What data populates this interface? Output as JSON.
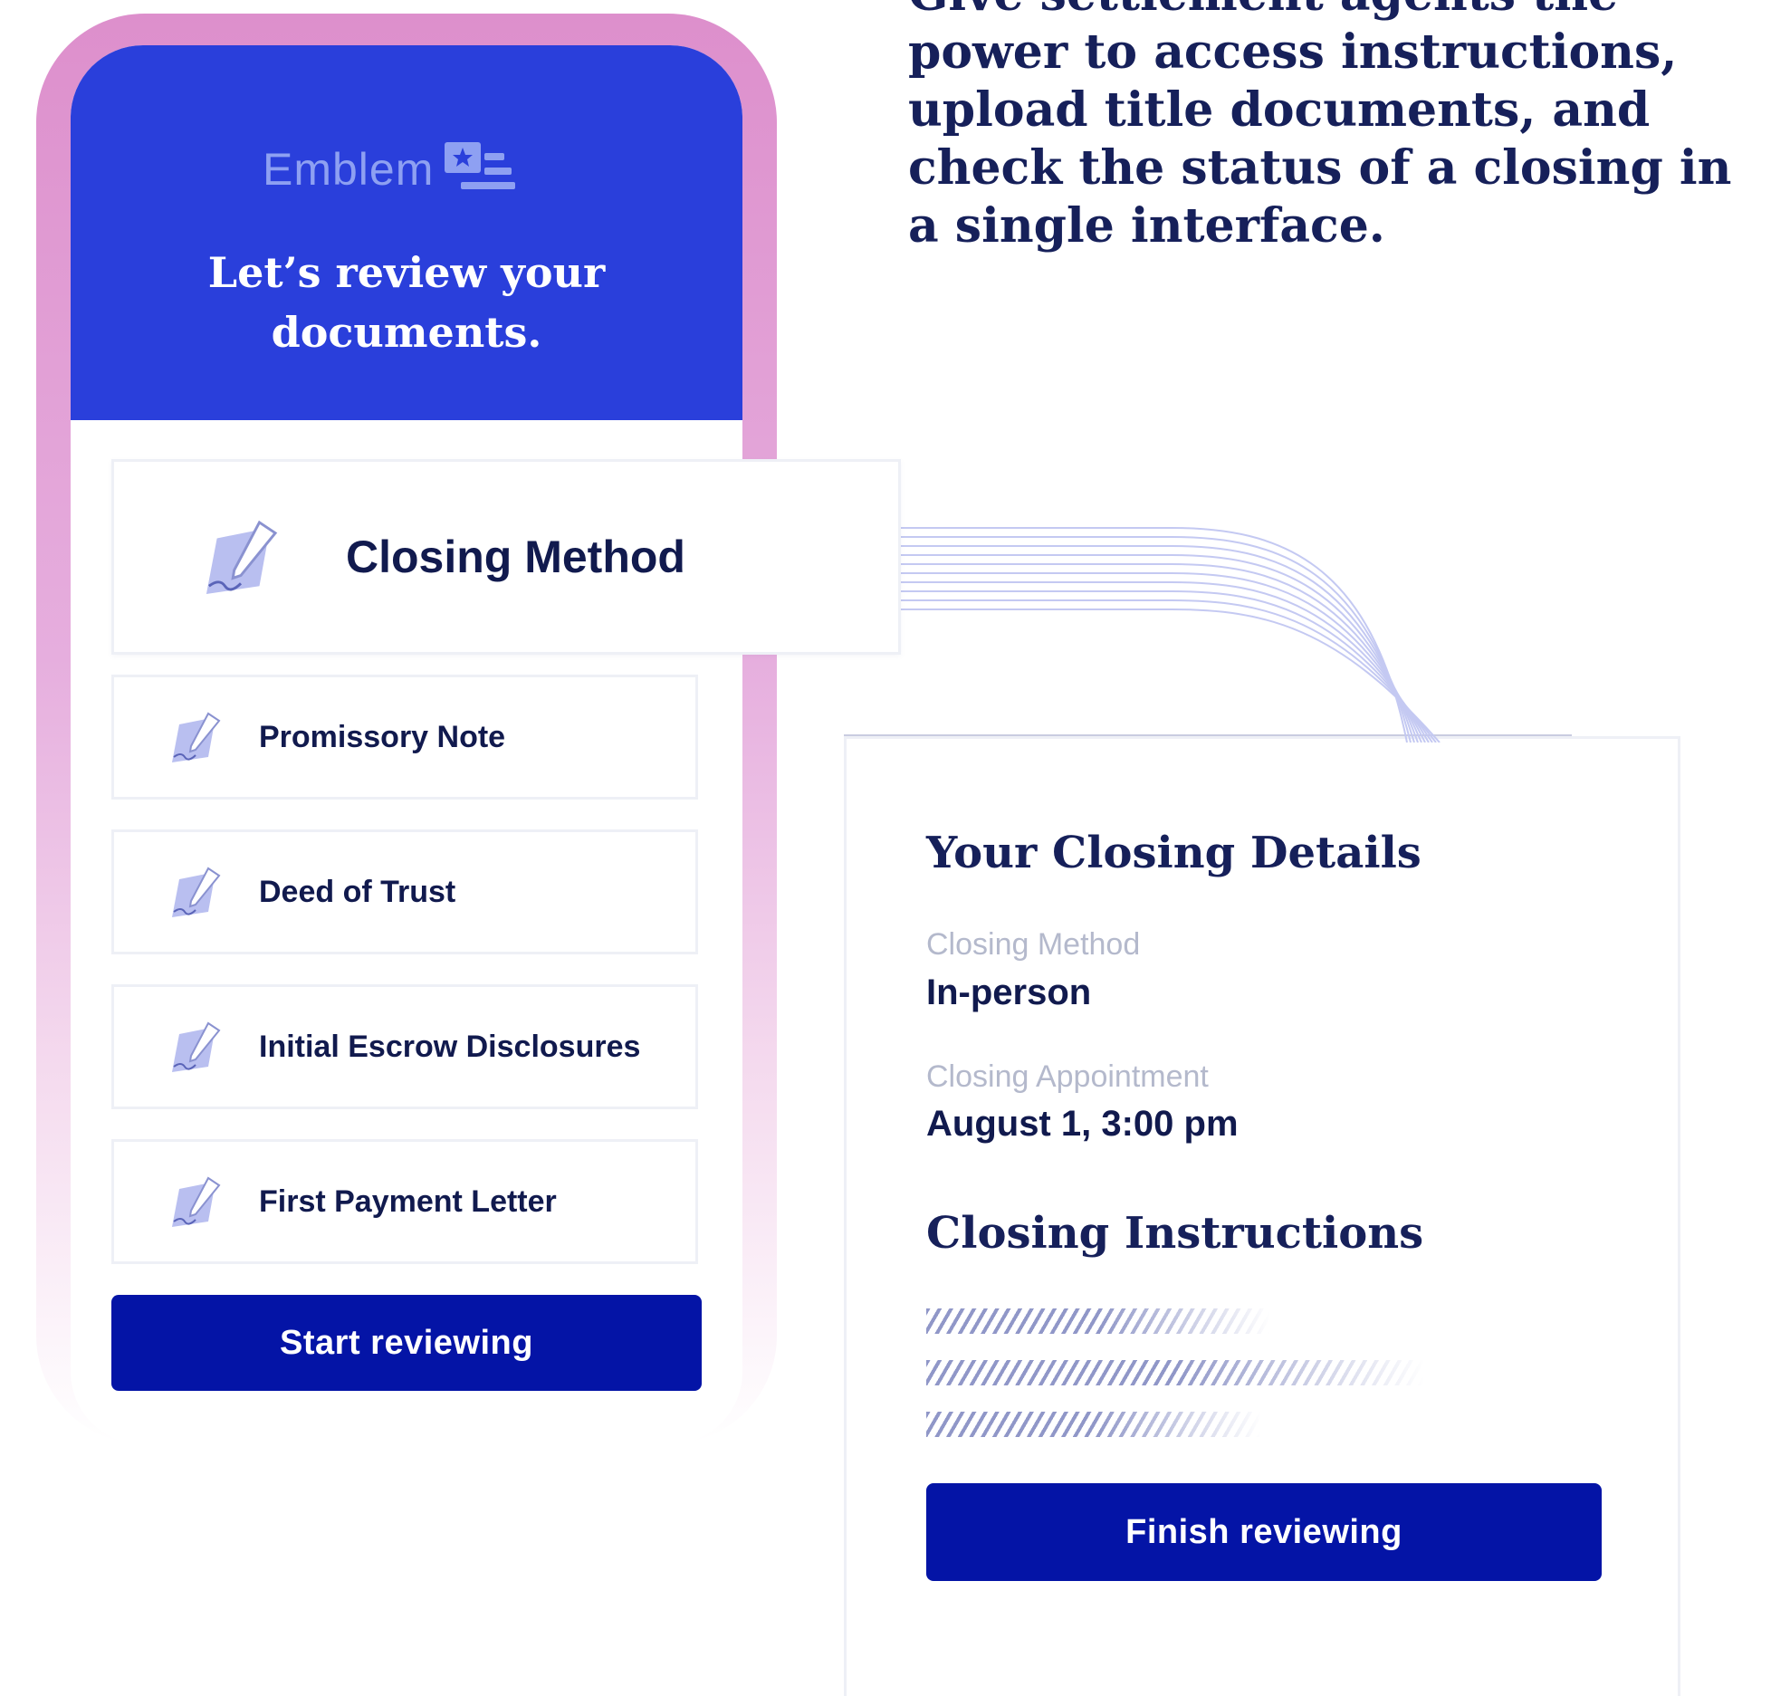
{
  "headline": "Give settlement agents the power to access instructions, upload title documents, and check the status of a closing in a single interface.",
  "phone": {
    "brand": "Emblem",
    "title_line1": "Let’s review your",
    "title_line2": "documents.",
    "featured_document": "Closing Method",
    "documents": [
      "Promissory Note",
      "Deed of Trust",
      "Initial Escrow Disclosures",
      "First Payment Letter"
    ],
    "start_button": "Start reviewing"
  },
  "details": {
    "title": "Your Closing Details",
    "fields": [
      {
        "label": "Closing Method",
        "value": "In-person"
      },
      {
        "label": "Closing Appointment",
        "value": "August 1, 3:00 pm"
      }
    ],
    "instructions_title": "Closing Instructions",
    "finish_button": "Finish reviewing"
  },
  "colors": {
    "header_blue": "#2a3fdb",
    "button_blue": "#0414a6",
    "navy_text": "#111a4e",
    "frame_pink": "#dd8fcc"
  }
}
